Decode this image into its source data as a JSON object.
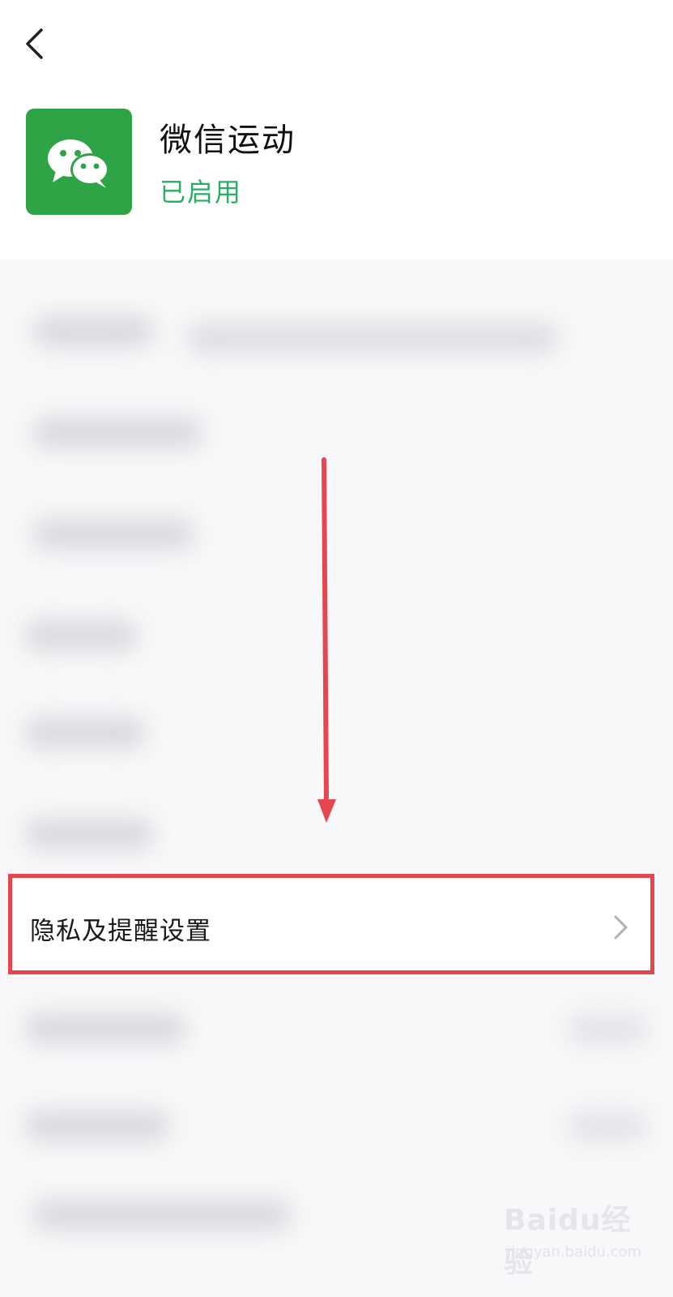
{
  "app": {
    "name": "微信运动",
    "status": "已启用"
  },
  "settings": {
    "privacy_reminder_label": "隐私及提醒设置"
  },
  "watermark": {
    "brand": "Baidu经验",
    "url": "jingyan.baidu.com"
  },
  "colors": {
    "app_icon_bg": "#2ea446",
    "status_green": "#2aae67",
    "highlight_red": "#e5474f"
  }
}
